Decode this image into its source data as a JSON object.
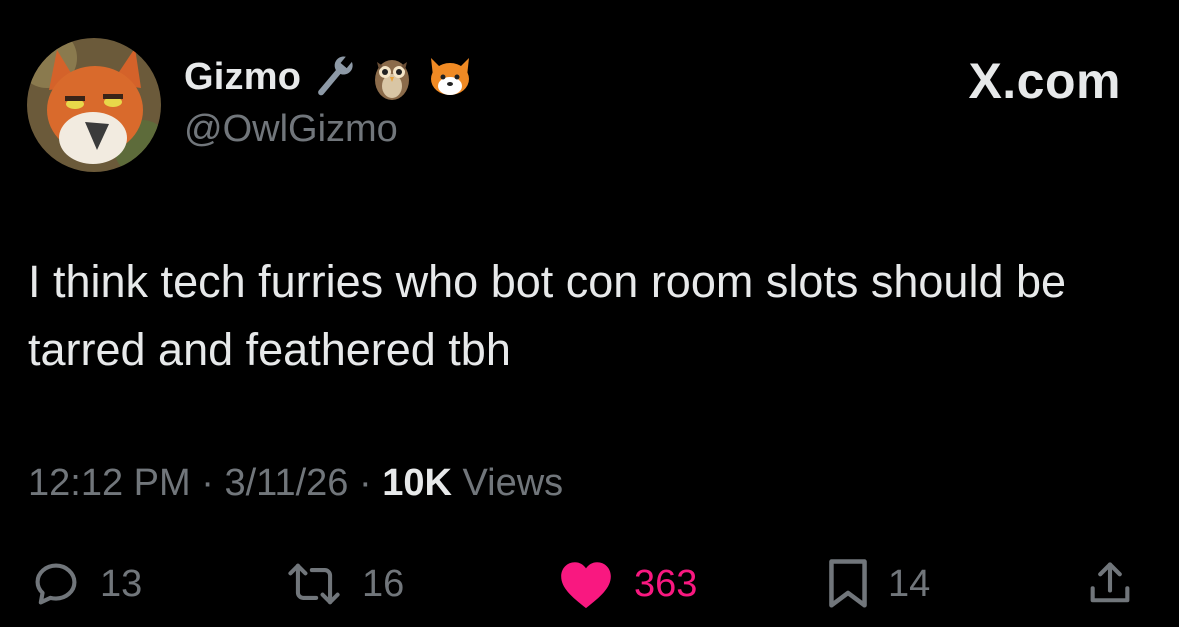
{
  "author": {
    "display_name": "Gizmo",
    "handle": "@OwlGizmo",
    "name_emojis": [
      "wrench-emoji",
      "owl-emoji",
      "fox-emoji"
    ],
    "avatar": "fox-character-avatar"
  },
  "site_label": "X.com",
  "tweet": {
    "text": "I think tech furries who bot con room slots should be tarred and feathered tbh"
  },
  "meta": {
    "time": "12:12 PM",
    "separator": "·",
    "date": "3/11/26",
    "views_count": "10K",
    "views_label": "Views"
  },
  "actions": {
    "replies": "13",
    "reposts": "16",
    "likes": "363",
    "bookmarks": "14"
  },
  "colors": {
    "background": "#000000",
    "primary_text": "#e7e9ea",
    "secondary_text": "#71767b",
    "like": "#f91880"
  }
}
